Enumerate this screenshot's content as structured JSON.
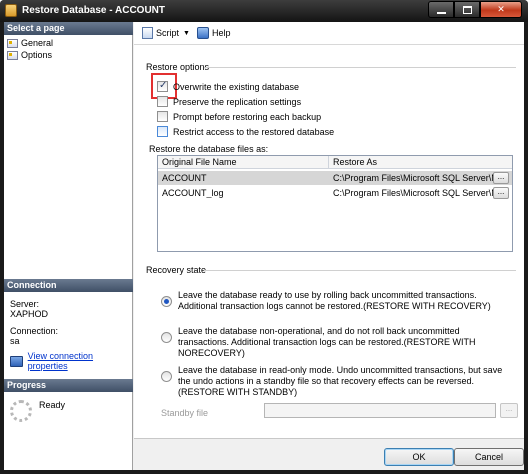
{
  "window": {
    "title": "Restore Database - ACCOUNT",
    "minimize_label": "",
    "maximize_label": "",
    "close_label": "✕"
  },
  "left_pane": {
    "select_page_header": "Select a page",
    "pages": [
      {
        "label": "General"
      },
      {
        "label": "Options"
      }
    ],
    "connection_header": "Connection",
    "server_label": "Server:",
    "server_value": "XAPHOD",
    "connection_label": "Connection:",
    "connection_value": "sa",
    "view_connection_link": "View connection properties",
    "progress_header": "Progress",
    "progress_status": "Ready"
  },
  "toolbar": {
    "script_label": "Script",
    "help_label": "Help"
  },
  "restore_options": {
    "section_title": "Restore options",
    "options": [
      {
        "label": "Overwrite the existing database",
        "checked": true
      },
      {
        "label": "Preserve the replication settings",
        "checked": false
      },
      {
        "label": "Prompt before restoring each backup",
        "checked": false
      },
      {
        "label": "Restrict access to the restored database",
        "checked": false
      }
    ]
  },
  "files": {
    "label": "Restore the database files as:",
    "columns": [
      "Original File Name",
      "Restore As"
    ],
    "rows": [
      {
        "original": "ACCOUNT",
        "restore_as": "C:\\Program Files\\Microsoft SQL Server\\MS...",
        "selected": true
      },
      {
        "original": "ACCOUNT_log",
        "restore_as": "C:\\Program Files\\Microsoft SQL Server\\MS...",
        "selected": false
      }
    ],
    "browse_label": "..."
  },
  "recovery": {
    "section_title": "Recovery state",
    "options": [
      {
        "label": "Leave the database ready to use by rolling back uncommitted transactions. Additional transaction logs cannot be restored.(RESTORE WITH RECOVERY)",
        "checked": true
      },
      {
        "label": "Leave the database non-operational, and do not roll back uncommitted transactions. Additional transaction logs can be restored.(RESTORE WITH NORECOVERY)",
        "checked": false
      },
      {
        "label": "Leave the database in read-only mode. Undo uncommitted transactions, but save the undo actions in a standby file so that recovery effects can be reversed.(RESTORE WITH STANDBY)",
        "checked": false
      }
    ],
    "standby_label": "Standby file",
    "standby_value": "",
    "standby_browse_label": "..."
  },
  "footer": {
    "ok_label": "OK",
    "cancel_label": "Cancel"
  },
  "colors": {
    "highlight_box": "#e23030",
    "pane_header": "#4a5a72",
    "link": "#0033cc"
  }
}
